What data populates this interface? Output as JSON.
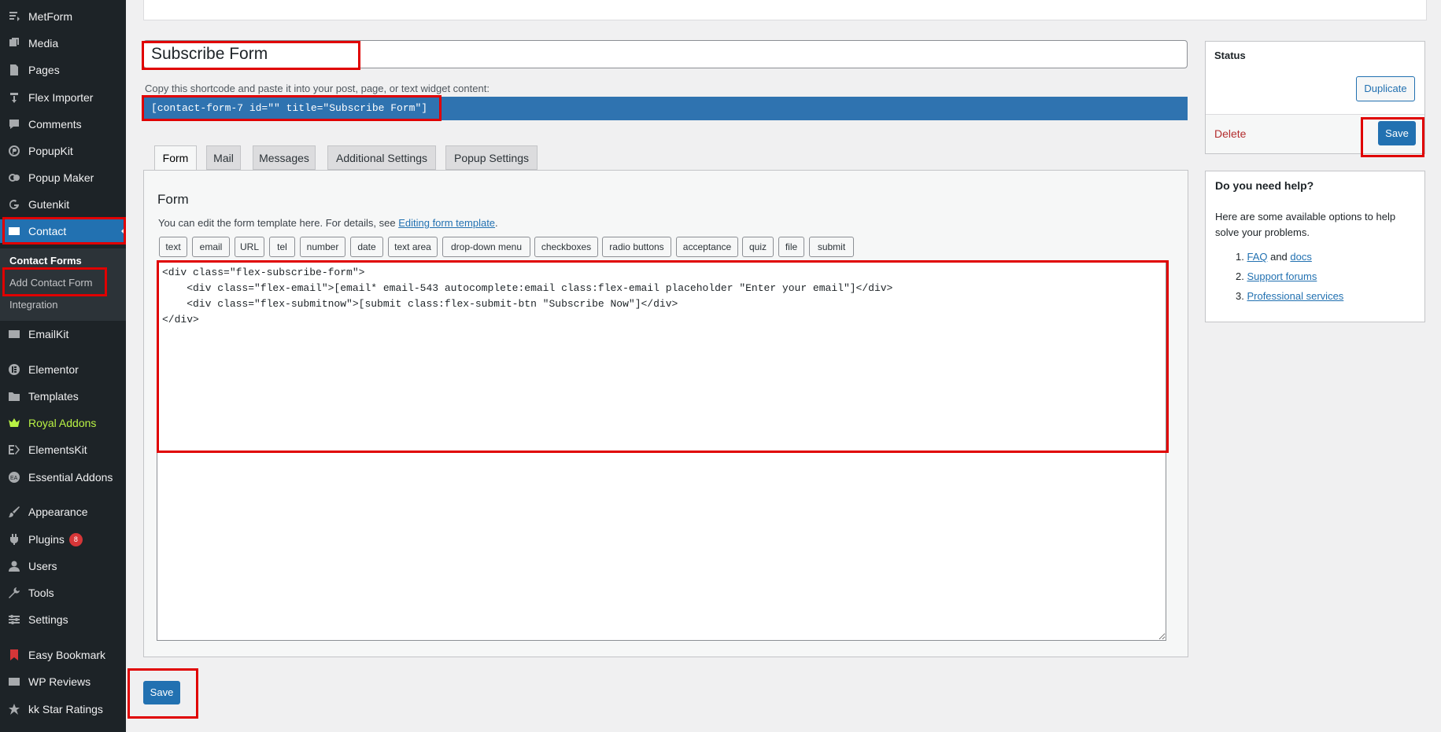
{
  "sidebar": {
    "items": [
      {
        "label": "MetForm",
        "icon": "metform-icon"
      },
      {
        "label": "Media",
        "icon": "media-icon"
      },
      {
        "label": "Pages",
        "icon": "pages-icon"
      },
      {
        "label": "Flex Importer",
        "icon": "import-icon"
      },
      {
        "label": "Comments",
        "icon": "comments-icon"
      },
      {
        "label": "PopupKit",
        "icon": "popupkit-icon"
      },
      {
        "label": "Popup Maker",
        "icon": "popup-maker-icon"
      },
      {
        "label": "Gutenkit",
        "icon": "gutenkit-icon"
      },
      {
        "label": "Contact",
        "icon": "mail-icon"
      },
      {
        "label": "EmailKit",
        "icon": "email-icon"
      },
      {
        "label": "Elementor",
        "icon": "elementor-icon"
      },
      {
        "label": "Templates",
        "icon": "folder-icon"
      },
      {
        "label": "Royal Addons",
        "icon": "crown-icon"
      },
      {
        "label": "ElementsKit",
        "icon": "elementskit-icon"
      },
      {
        "label": "Essential Addons",
        "icon": "essential-addons-icon"
      },
      {
        "label": "Appearance",
        "icon": "paintbrush-icon"
      },
      {
        "label": "Plugins",
        "icon": "plugin-icon",
        "badge": "8"
      },
      {
        "label": "Users",
        "icon": "user-icon"
      },
      {
        "label": "Tools",
        "icon": "wrench-icon"
      },
      {
        "label": "Settings",
        "icon": "settings-icon"
      },
      {
        "label": "Easy Bookmark",
        "icon": "bookmark-icon"
      },
      {
        "label": "WP Reviews",
        "icon": "reviews-icon"
      },
      {
        "label": "kk Star Ratings",
        "icon": "star-icon"
      }
    ],
    "submenu": [
      "Contact Forms",
      "Add Contact Form",
      "Integration"
    ]
  },
  "form": {
    "title": "Subscribe Form",
    "shortcode_hint": "Copy this shortcode and paste it into your post, page, or text widget content:",
    "shortcode": "[contact-form-7 id=\"\" title=\"Subscribe Form\"]",
    "tabs": [
      "Form",
      "Mail",
      "Messages",
      "Additional Settings",
      "Popup Settings"
    ],
    "panel_title": "Form",
    "panel_hint": "You can edit the form template here. For details, see ",
    "panel_hint_link": "Editing form template",
    "panel_hint_end": ".",
    "tag_buttons": [
      "text",
      "email",
      "URL",
      "tel",
      "number",
      "date",
      "text area",
      "drop-down menu",
      "checkboxes",
      "radio buttons",
      "acceptance",
      "quiz",
      "file",
      "submit"
    ],
    "template": "<div class=\"flex-subscribe-form\">\n    <div class=\"flex-email\">[email* email-543 autocomplete:email class:flex-email placeholder \"Enter your email\"]</div>\n    <div class=\"flex-submitnow\">[submit class:flex-submit-btn \"Subscribe Now\"]</div>\n</div>",
    "save_bottom": "Save"
  },
  "status_box": {
    "title": "Status",
    "duplicate": "Duplicate",
    "delete": "Delete",
    "save": "Save"
  },
  "help_box": {
    "title": "Do you need help?",
    "intro": "Here are some available options to help solve your problems.",
    "items": [
      {
        "num": "1.",
        "link": "FAQ",
        "mid": " and ",
        "link2": "docs"
      },
      {
        "num": "2.",
        "link": "Support forums"
      },
      {
        "num": "3.",
        "link": "Professional services"
      }
    ]
  },
  "colors": {
    "sidebar_bg": "#1d2327",
    "accent": "#2271b1",
    "highlight": "#e00000",
    "royal_addons": "#b9f244",
    "delete": "#b32d2e"
  }
}
